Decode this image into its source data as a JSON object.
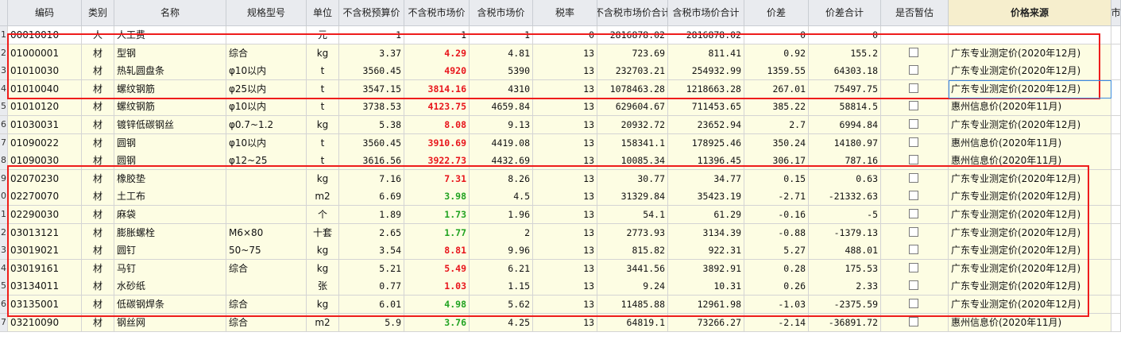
{
  "columns": [
    "",
    "编码",
    "类别",
    "名称",
    "规格型号",
    "单位",
    "不含税预算价",
    "不含税市场价",
    "含税市场价",
    "税率",
    "不含税市场价合计",
    "含税市场价合计",
    "价差",
    "价差合计",
    "是否暂估",
    "价格来源",
    "市"
  ],
  "rows": [
    {
      "rn": "1",
      "code": "00010010",
      "type": "人",
      "name": "人工费",
      "spec": "",
      "unit": "元",
      "budget": "1",
      "market": "1",
      "market_color": "",
      "tax_market": "1",
      "rate": "0",
      "total": "2816878.02",
      "tax_total": "2816878.02",
      "diff": "0",
      "diff_total": "0",
      "has_check": false,
      "source": ""
    },
    {
      "rn": "2",
      "code": "01000001",
      "type": "材",
      "name": "型钢",
      "spec": "综合",
      "unit": "kg",
      "budget": "3.37",
      "market": "4.29",
      "market_color": "red",
      "tax_market": "4.81",
      "rate": "13",
      "total": "723.69",
      "tax_total": "811.41",
      "diff": "0.92",
      "diff_total": "155.2",
      "has_check": true,
      "source": "广东专业测定价(2020年12月)"
    },
    {
      "rn": "3",
      "code": "01010030",
      "type": "材",
      "name": "热轧圆盘条",
      "spec": "φ10以内",
      "unit": "t",
      "budget": "3560.45",
      "market": "4920",
      "market_color": "red",
      "tax_market": "5390",
      "rate": "13",
      "total": "232703.21",
      "tax_total": "254932.99",
      "diff": "1359.55",
      "diff_total": "64303.18",
      "has_check": true,
      "source": "广东专业测定价(2020年12月)"
    },
    {
      "rn": "4",
      "code": "01010040",
      "type": "材",
      "name": "螺纹钢筋",
      "spec": "φ25以内",
      "unit": "t",
      "budget": "3547.15",
      "market": "3814.16",
      "market_color": "red",
      "tax_market": "4310",
      "rate": "13",
      "total": "1078463.28",
      "tax_total": "1218663.28",
      "diff": "267.01",
      "diff_total": "75497.75",
      "has_check": true,
      "source": "广东专业测定价(2020年12月)"
    },
    {
      "rn": "5",
      "code": "01010120",
      "type": "材",
      "name": "螺纹钢筋",
      "spec": "φ10以内",
      "unit": "t",
      "budget": "3738.53",
      "market": "4123.75",
      "market_color": "red",
      "tax_market": "4659.84",
      "rate": "13",
      "total": "629604.67",
      "tax_total": "711453.65",
      "diff": "385.22",
      "diff_total": "58814.5",
      "has_check": true,
      "source": "惠州信息价(2020年11月)"
    },
    {
      "rn": "6",
      "code": "01030031",
      "type": "材",
      "name": "镀锌低碳钢丝",
      "spec": "φ0.7~1.2",
      "unit": "kg",
      "budget": "5.38",
      "market": "8.08",
      "market_color": "red",
      "tax_market": "9.13",
      "rate": "13",
      "total": "20932.72",
      "tax_total": "23652.94",
      "diff": "2.7",
      "diff_total": "6994.84",
      "has_check": true,
      "source": "广东专业测定价(2020年12月)"
    },
    {
      "rn": "7",
      "code": "01090022",
      "type": "材",
      "name": "圆钢",
      "spec": "φ10以内",
      "unit": "t",
      "budget": "3560.45",
      "market": "3910.69",
      "market_color": "red",
      "tax_market": "4419.08",
      "rate": "13",
      "total": "158341.1",
      "tax_total": "178925.46",
      "diff": "350.24",
      "diff_total": "14180.97",
      "has_check": true,
      "source": "惠州信息价(2020年11月)"
    },
    {
      "rn": "8",
      "code": "01090030",
      "type": "材",
      "name": "圆钢",
      "spec": "φ12~25",
      "unit": "t",
      "budget": "3616.56",
      "market": "3922.73",
      "market_color": "red",
      "tax_market": "4432.69",
      "rate": "13",
      "total": "10085.34",
      "tax_total": "11396.45",
      "diff": "306.17",
      "diff_total": "787.16",
      "has_check": true,
      "source": "惠州信息价(2020年11月)"
    },
    {
      "rn": "9",
      "code": "02070230",
      "type": "材",
      "name": "橡胶垫",
      "spec": "",
      "unit": "kg",
      "budget": "7.16",
      "market": "7.31",
      "market_color": "red",
      "tax_market": "8.26",
      "rate": "13",
      "total": "30.77",
      "tax_total": "34.77",
      "diff": "0.15",
      "diff_total": "0.63",
      "has_check": true,
      "source": "广东专业测定价(2020年12月)"
    },
    {
      "rn": "0",
      "code": "02270070",
      "type": "材",
      "name": "土工布",
      "spec": "",
      "unit": "m2",
      "budget": "6.69",
      "market": "3.98",
      "market_color": "green",
      "tax_market": "4.5",
      "rate": "13",
      "total": "31329.84",
      "tax_total": "35423.19",
      "diff": "-2.71",
      "diff_total": "-21332.63",
      "has_check": true,
      "source": "广东专业测定价(2020年12月)"
    },
    {
      "rn": "1",
      "code": "02290030",
      "type": "材",
      "name": "麻袋",
      "spec": "",
      "unit": "个",
      "budget": "1.89",
      "market": "1.73",
      "market_color": "green",
      "tax_market": "1.96",
      "rate": "13",
      "total": "54.1",
      "tax_total": "61.29",
      "diff": "-0.16",
      "diff_total": "-5",
      "has_check": true,
      "source": "广东专业测定价(2020年12月)"
    },
    {
      "rn": "2",
      "code": "03013121",
      "type": "材",
      "name": "膨胀螺栓",
      "spec": "M6×80",
      "unit": "十套",
      "budget": "2.65",
      "market": "1.77",
      "market_color": "green",
      "tax_market": "2",
      "rate": "13",
      "total": "2773.93",
      "tax_total": "3134.39",
      "diff": "-0.88",
      "diff_total": "-1379.13",
      "has_check": true,
      "source": "广东专业测定价(2020年12月)"
    },
    {
      "rn": "3",
      "code": "03019021",
      "type": "材",
      "name": "圆钉",
      "spec": "50~75",
      "unit": "kg",
      "budget": "3.54",
      "market": "8.81",
      "market_color": "red",
      "tax_market": "9.96",
      "rate": "13",
      "total": "815.82",
      "tax_total": "922.31",
      "diff": "5.27",
      "diff_total": "488.01",
      "has_check": true,
      "source": "广东专业测定价(2020年12月)"
    },
    {
      "rn": "4",
      "code": "03019161",
      "type": "材",
      "name": "马钉",
      "spec": "综合",
      "unit": "kg",
      "budget": "5.21",
      "market": "5.49",
      "market_color": "red",
      "tax_market": "6.21",
      "rate": "13",
      "total": "3441.56",
      "tax_total": "3892.91",
      "diff": "0.28",
      "diff_total": "175.53",
      "has_check": true,
      "source": "广东专业测定价(2020年12月)"
    },
    {
      "rn": "5",
      "code": "03134011",
      "type": "材",
      "name": "水砂纸",
      "spec": "",
      "unit": "张",
      "budget": "0.77",
      "market": "1.03",
      "market_color": "red",
      "tax_market": "1.15",
      "rate": "13",
      "total": "9.24",
      "tax_total": "10.31",
      "diff": "0.26",
      "diff_total": "2.33",
      "has_check": true,
      "source": "广东专业测定价(2020年12月)"
    },
    {
      "rn": "6",
      "code": "03135001",
      "type": "材",
      "name": "低碳钢焊条",
      "spec": "综合",
      "unit": "kg",
      "budget": "6.01",
      "market": "4.98",
      "market_color": "green",
      "tax_market": "5.62",
      "rate": "13",
      "total": "11485.88",
      "tax_total": "12961.98",
      "diff": "-1.03",
      "diff_total": "-2375.59",
      "has_check": true,
      "source": "广东专业测定价(2020年12月)"
    },
    {
      "rn": "7",
      "code": "03210090",
      "type": "材",
      "name": "钢丝网",
      "spec": "综合",
      "unit": "m2",
      "budget": "5.9",
      "market": "3.76",
      "market_color": "green",
      "tax_market": "4.25",
      "rate": "13",
      "total": "64819.1",
      "tax_total": "73266.27",
      "diff": "-2.14",
      "diff_total": "-36891.72",
      "has_check": true,
      "source": "惠州信息价(2020年11月)"
    }
  ],
  "colors": {
    "header_bg": "#e9ebef",
    "source_header_bg": "#f6eecd",
    "row_bg": "#fdfde3",
    "up_price": "#e8141b",
    "down_price": "#21a321",
    "annotation_box": "#ee1c1c",
    "selection_box": "#3b8be0"
  }
}
